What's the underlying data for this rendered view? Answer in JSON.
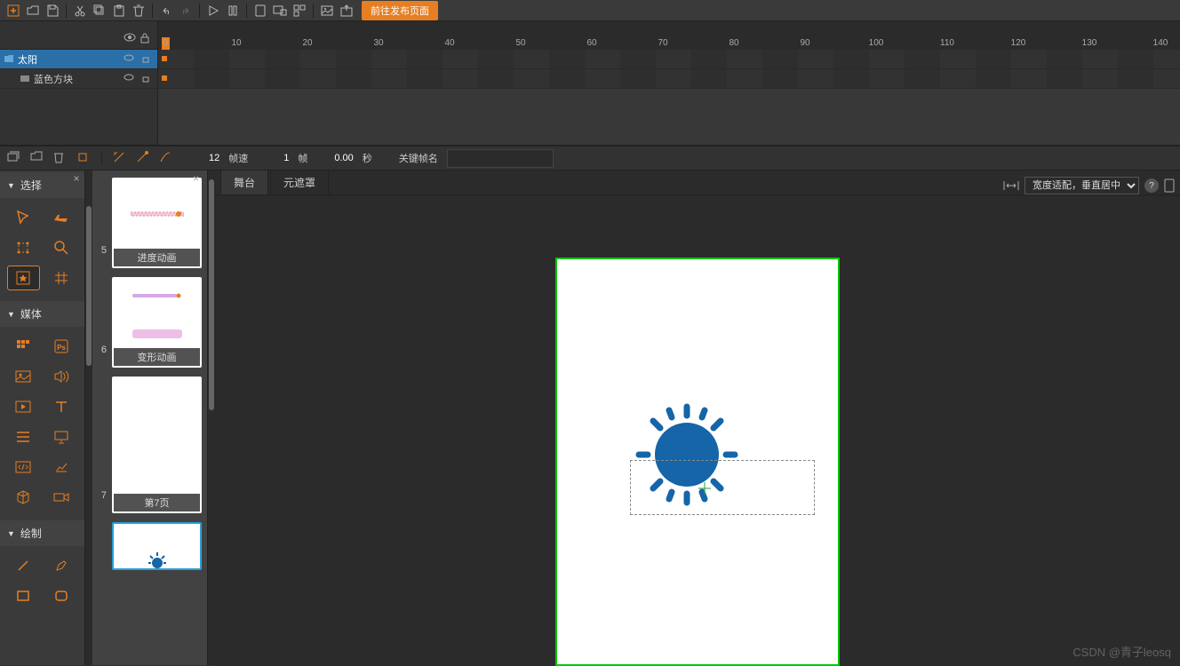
{
  "toolbar": {
    "publish_btn": "前往发布页面"
  },
  "timeline": {
    "layers": [
      {
        "name": "太阳",
        "selected": true,
        "indent": 0,
        "icon": "folder"
      },
      {
        "name": "蓝色方块",
        "selected": false,
        "indent": 1,
        "icon": "layer"
      }
    ],
    "ruler_ticks": [
      0,
      10,
      20,
      30,
      40,
      50,
      60,
      70,
      80,
      90,
      100,
      110,
      120,
      130,
      140
    ]
  },
  "tl_footer": {
    "fps_num": "12",
    "fps_label": "帧速",
    "frame_num": "1",
    "frame_label": "帧",
    "time_num": "0.00",
    "time_label": "秒",
    "kfname_label": "关键帧名"
  },
  "palette": {
    "sections": {
      "select": "选择",
      "media": "媒体",
      "draw": "绘制"
    }
  },
  "thumbs": [
    {
      "num": "5",
      "label": "进度动画",
      "type": "progress"
    },
    {
      "num": "6",
      "label": "变形动画",
      "type": "morph"
    },
    {
      "num": "7",
      "label": "第7页",
      "type": "blank"
    },
    {
      "num": "",
      "label": "",
      "type": "sun",
      "selected": true
    }
  ],
  "stage": {
    "tabs": {
      "stage": "舞台",
      "mask": "元遮罩"
    },
    "fit_mode": "宽度适配，垂直居中",
    "help": "?"
  },
  "watermark": "CSDN @青子leosq"
}
